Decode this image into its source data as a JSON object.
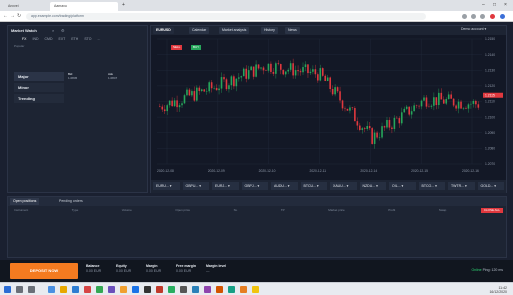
{
  "browser": {
    "tabs": [
      "Anxvei",
      "Aamaxu"
    ],
    "url": "app.example.com/trading/platform",
    "extensions": [
      "gray",
      "gray",
      "gray",
      "red",
      "blue"
    ]
  },
  "left_panel": {
    "title": "Market Watch",
    "tabs": [
      "FX",
      "IND",
      "CMD",
      "EXT",
      "ETH",
      "STO",
      "...",
      "..."
    ],
    "subtitle": "Popular",
    "categories": [
      "Major",
      "Minor",
      "Trending"
    ],
    "quotes": [
      {
        "label": "Bid",
        "value": "1.0845"
      },
      {
        "label": "Ask",
        "value": "1.0847"
      }
    ]
  },
  "chart": {
    "tabs": [
      "EURUSD",
      "Calendar",
      "Market analysis",
      "History",
      "News"
    ],
    "toolbar_right": "Demo account  ▾",
    "sell_badge": "SELL",
    "buy_badge": "BUY",
    "time_axis": [
      "2020-12-08",
      "2020-12-09",
      "2020-12-10",
      "2020-12-11",
      "2020-12-14",
      "2020-12-15",
      "2020-12-16"
    ],
    "price_axis": [
      "1.2150",
      "1.2140",
      "1.2130",
      "1.2120",
      "1.2110",
      "1.2100",
      "1.2090",
      "1.2080",
      "1.2070"
    ],
    "last_price_tag": "1.2115",
    "colors": {
      "up": "#26a65b",
      "down": "#e0383e",
      "bg": "#131826"
    }
  },
  "chart_data": {
    "type": "candlestick",
    "title": "EURUSD",
    "x": [
      "2020-12-08",
      "2020-12-09",
      "2020-12-10",
      "2020-12-11",
      "2020-12-14",
      "2020-12-15",
      "2020-12-16"
    ],
    "close": [
      1.2106,
      1.2121,
      1.2139,
      1.2132,
      1.2081,
      1.2112,
      1.2108
    ],
    "ylim": [
      1.206,
      1.216
    ]
  },
  "watchlist": [
    "EURU... ▾",
    "GBPU... ▾",
    "EURJ... ▾",
    "GBPJ... ▾",
    "AUDU... ▾",
    "BTCU... ▾",
    "XAUU... ▾",
    "NZDU... ▾",
    "OIL... ▾",
    "BTCO... ▾",
    "TWTR... ▾",
    "GOLD... ▾"
  ],
  "bottom_panel": {
    "tabs": [
      "Open positions",
      "Pending orders"
    ],
    "headers": [
      "Instrument",
      "Type",
      "Volume",
      "Open price",
      "SL",
      "TP",
      "Market price",
      "Profit",
      "Swap",
      "Net P/L"
    ],
    "close_all": "CLOSE ALL"
  },
  "footer": {
    "deposit_button": "DEPOSIT NOW",
    "stats": [
      {
        "label": "Balance",
        "value": "0.00 EUR"
      },
      {
        "label": "Equity",
        "value": "0.00 EUR"
      },
      {
        "label": "Margin",
        "value": "0.00 EUR"
      },
      {
        "label": "Free margin",
        "value": "0.00 EUR"
      },
      {
        "label": "Margin level",
        "value": "—"
      }
    ],
    "status": "Online",
    "ping": "Ping: 120 ms"
  },
  "taskbar": {
    "clock_time": "11:42",
    "clock_date": "16/12/2020"
  }
}
